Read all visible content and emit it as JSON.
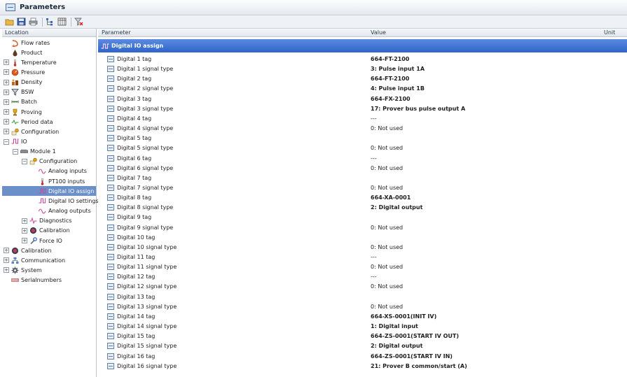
{
  "window": {
    "title": "Parameters"
  },
  "toolbar": {
    "buttons": [
      {
        "name": "open-folder",
        "icon": "folder-icon"
      },
      {
        "name": "save",
        "icon": "save-icon"
      },
      {
        "name": "print",
        "icon": "printer-icon"
      },
      {
        "name": "tree-view",
        "icon": "tree-icon"
      },
      {
        "name": "table-view",
        "icon": "table-icon"
      },
      {
        "name": "clear-filter",
        "icon": "filter-clear-icon"
      }
    ]
  },
  "location_panel": {
    "header": "Location",
    "tree": [
      {
        "label": "Flow rates",
        "icon": "flow-rate-icon",
        "depth": 0,
        "expander": ""
      },
      {
        "label": "Product",
        "icon": "drop-icon",
        "depth": 0,
        "expander": ""
      },
      {
        "label": "Temperature",
        "icon": "thermometer-icon",
        "depth": 0,
        "expander": "+"
      },
      {
        "label": "Pressure",
        "icon": "pressure-icon",
        "depth": 0,
        "expander": "+"
      },
      {
        "label": "Density",
        "icon": "density-icon",
        "depth": 0,
        "expander": "+"
      },
      {
        "label": "BSW",
        "icon": "funnel-icon",
        "depth": 0,
        "expander": "+"
      },
      {
        "label": "Batch",
        "icon": "batch-icon",
        "depth": 0,
        "expander": "+"
      },
      {
        "label": "Proving",
        "icon": "trophy-icon",
        "depth": 0,
        "expander": "+"
      },
      {
        "label": "Period data",
        "icon": "period-icon",
        "depth": 0,
        "expander": "+"
      },
      {
        "label": "Configuration",
        "icon": "config-icon",
        "depth": 0,
        "expander": "+"
      },
      {
        "label": "IO",
        "icon": "io-icon",
        "depth": 0,
        "expander": "−"
      },
      {
        "label": "Module 1",
        "icon": "module-icon",
        "depth": 1,
        "expander": "−"
      },
      {
        "label": "Configuration",
        "icon": "config-icon",
        "depth": 2,
        "expander": "−"
      },
      {
        "label": "Analog inputs",
        "icon": "wave-icon",
        "depth": 3,
        "expander": ""
      },
      {
        "label": "PT100 inputs",
        "icon": "thermometer-icon",
        "depth": 3,
        "expander": ""
      },
      {
        "label": "Digital IO assign",
        "icon": "digital-icon",
        "depth": 3,
        "expander": "",
        "selected": true
      },
      {
        "label": "Digital IO settings",
        "icon": "digital-icon",
        "depth": 3,
        "expander": ""
      },
      {
        "label": "Analog outputs",
        "icon": "wave-icon",
        "depth": 3,
        "expander": ""
      },
      {
        "label": "Diagnostics",
        "icon": "pulse-icon",
        "depth": 2,
        "expander": "+"
      },
      {
        "label": "Calibration",
        "icon": "calibration-icon",
        "depth": 2,
        "expander": "+"
      },
      {
        "label": "Force IO",
        "icon": "wrench-icon",
        "depth": 2,
        "expander": "+"
      },
      {
        "label": "Calibration",
        "icon": "calibration-icon",
        "depth": 0,
        "expander": "+"
      },
      {
        "label": "Communication",
        "icon": "network-icon",
        "depth": 0,
        "expander": "+"
      },
      {
        "label": "System",
        "icon": "gear-icon",
        "depth": 0,
        "expander": "+"
      },
      {
        "label": "Serialnumbers",
        "icon": "serial-icon",
        "depth": 0,
        "expander": ""
      }
    ]
  },
  "parameter_panel": {
    "columns": {
      "parameter": "Parameter",
      "value": "Value",
      "unit": "Unit"
    },
    "group_title": "Digital IO assign",
    "rows": [
      {
        "name": "Digital 1 tag",
        "value": "664-FT-2100",
        "bold": true
      },
      {
        "name": "Digital 1 signal type",
        "value": "3: Pulse input 1A",
        "bold": true
      },
      {
        "name": "Digital 2 tag",
        "value": "664-FT-2100",
        "bold": true
      },
      {
        "name": "Digital 2 signal type",
        "value": "4: Pulse input 1B",
        "bold": true
      },
      {
        "name": "Digital 3 tag",
        "value": "664-FX-2100",
        "bold": true
      },
      {
        "name": "Digital 3 signal type",
        "value": "17: Prover bus pulse output A",
        "bold": true
      },
      {
        "name": "Digital 4 tag",
        "value": "---",
        "bold": false
      },
      {
        "name": "Digital 4 signal type",
        "value": "0: Not used",
        "bold": false
      },
      {
        "name": "Digital 5 tag",
        "value": "",
        "bold": false
      },
      {
        "name": "Digital 5 signal type",
        "value": "0: Not used",
        "bold": false
      },
      {
        "name": "Digital 6 tag",
        "value": "---",
        "bold": false
      },
      {
        "name": "Digital 6 signal type",
        "value": "0: Not used",
        "bold": false
      },
      {
        "name": "Digital 7 tag",
        "value": "",
        "bold": false
      },
      {
        "name": "Digital 7 signal type",
        "value": "0: Not used",
        "bold": false
      },
      {
        "name": "Digital 8 tag",
        "value": "664-XA-0001",
        "bold": true
      },
      {
        "name": "Digital 8 signal type",
        "value": "2: Digital output",
        "bold": true
      },
      {
        "name": "Digital 9 tag",
        "value": "",
        "bold": false
      },
      {
        "name": "Digital 9 signal type",
        "value": "0: Not used",
        "bold": false
      },
      {
        "name": "Digital 10 tag",
        "value": "",
        "bold": false
      },
      {
        "name": "Digital 10 signal type",
        "value": "0: Not used",
        "bold": false
      },
      {
        "name": "Digital 11 tag",
        "value": "---",
        "bold": false
      },
      {
        "name": "Digital 11 signal type",
        "value": "0: Not used",
        "bold": false
      },
      {
        "name": "Digital 12 tag",
        "value": "---",
        "bold": false
      },
      {
        "name": "Digital 12 signal type",
        "value": "0: Not used",
        "bold": false
      },
      {
        "name": "Digital 13 tag",
        "value": "",
        "bold": false
      },
      {
        "name": "Digital 13 signal type",
        "value": "0: Not used",
        "bold": false
      },
      {
        "name": "Digital 14 tag",
        "value": "664-XS-0001(INIT IV)",
        "bold": true
      },
      {
        "name": "Digital 14 signal type",
        "value": "1: Digital input",
        "bold": true
      },
      {
        "name": "Digital 15 tag",
        "value": "664-ZS-0001(START IV OUT)",
        "bold": true
      },
      {
        "name": "Digital 15 signal type",
        "value": "2: Digital output",
        "bold": true
      },
      {
        "name": "Digital 16 tag",
        "value": "664-ZS-0001(START IV IN)",
        "bold": true
      },
      {
        "name": "Digital 16 signal type",
        "value": "21: Prover B common/start (A)",
        "bold": true
      }
    ]
  }
}
